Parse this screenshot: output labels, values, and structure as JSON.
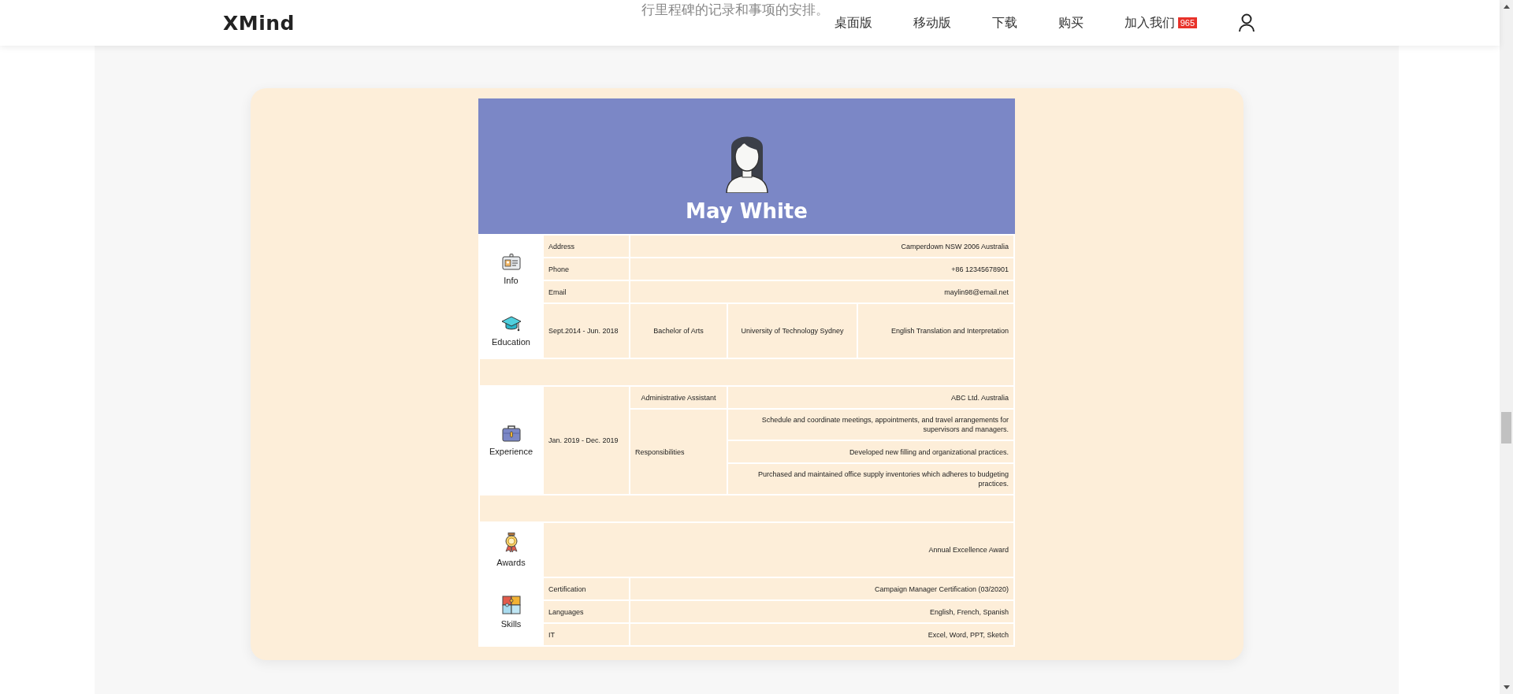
{
  "background_text": "行里程碑的记录和事项的安排。",
  "header": {
    "logo": "XMind",
    "nav": [
      {
        "label": "桌面版"
      },
      {
        "label": "移动版"
      },
      {
        "label": "下载"
      },
      {
        "label": "购买"
      },
      {
        "label": "加入我们",
        "badge": "965"
      }
    ]
  },
  "resume": {
    "name": "May White",
    "sections": [
      {
        "kind": "info",
        "title": "Info",
        "rows": [
          {
            "label": "Address",
            "value": "Camperdown NSW 2006 Australia"
          },
          {
            "label": "Phone",
            "value": "+86 12345678901"
          },
          {
            "label": "Email",
            "value": "maylin98@email.net"
          }
        ]
      },
      {
        "kind": "education",
        "title": "Education",
        "period": "Sept.2014 - Jun. 2018",
        "degree": "Bachelor of Arts",
        "school": "University of Technology Sydney",
        "major": "English Translation and Interpretation"
      },
      {
        "kind": "spacer"
      },
      {
        "kind": "experience",
        "title": "Experience",
        "period": "Jan. 2019 - Dec. 2019",
        "role": "Administrative Assistant",
        "company": "ABC Ltd. Australia",
        "duties_label": "Responsibilities",
        "duties": [
          "Schedule and coordinate meetings, appointments, and travel arrangements for supervisors and managers.",
          "Developed new filling and organizational practices.",
          "Purchased and maintained office supply inventories which adheres to budgeting practices."
        ]
      },
      {
        "kind": "spacer"
      },
      {
        "kind": "awards",
        "title": "Awards",
        "value": "Annual Excellence Award"
      },
      {
        "kind": "skills",
        "title": "Skills",
        "rows": [
          {
            "label": "Certification",
            "value": "Campaign Manager Certification (03/2020)"
          },
          {
            "label": "Languages",
            "value": "English, French, Spanish"
          },
          {
            "label": "IT",
            "value": "Excel, Word, PPT, Sketch"
          }
        ]
      }
    ]
  }
}
